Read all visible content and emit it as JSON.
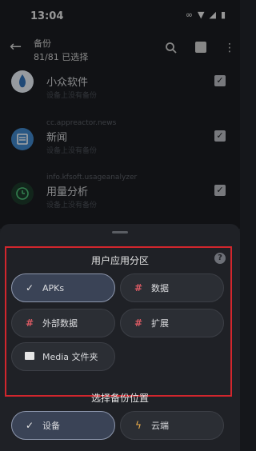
{
  "status": {
    "time": "13:04"
  },
  "appbar": {
    "title": "备份",
    "subtitle": "81/81 已选择"
  },
  "apps": [
    {
      "name": "小众软件",
      "note": "设备上没有备份",
      "package": ""
    },
    {
      "name": "新闻",
      "note": "设备上没有备份",
      "package": "cc.appreactor.news"
    },
    {
      "name": "用量分析",
      "note": "设备上没有备份",
      "package": "info.kfsoft.usageanalyzer"
    }
  ],
  "sheet": {
    "section1_title": "用户应用分区",
    "chips": [
      {
        "label": "APKs",
        "icon": "check-icon",
        "selected": true
      },
      {
        "label": "数据",
        "icon": "hash-icon",
        "selected": false
      },
      {
        "label": "外部数据",
        "icon": "hash-icon",
        "selected": false
      },
      {
        "label": "扩展",
        "icon": "hash-icon",
        "selected": false
      },
      {
        "label": "Media 文件夹",
        "icon": "folder-icon",
        "selected": false
      }
    ],
    "section2_title": "选择备份位置",
    "locations": [
      {
        "label": "设备",
        "icon": "check-icon",
        "selected": true
      },
      {
        "label": "云端",
        "icon": "bolt-icon",
        "selected": false
      }
    ]
  },
  "colors": {
    "highlight_border": "#d1262d",
    "hash": "#d95a63",
    "selected_chip": "#3a4356"
  }
}
